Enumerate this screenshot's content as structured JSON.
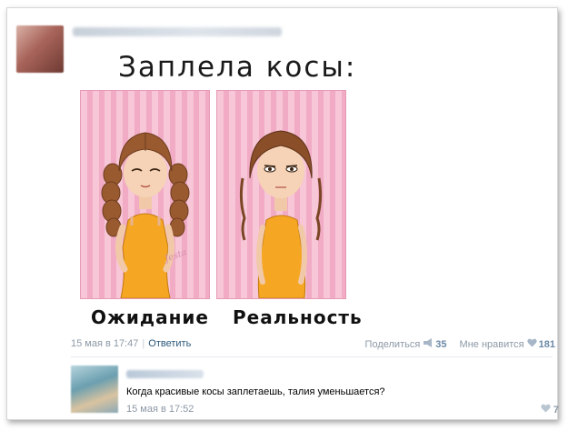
{
  "post": {
    "meme_title": "Заплела косы:",
    "captions": {
      "left": "Ожидание",
      "right": "Реальность"
    },
    "watermark": "Jesta",
    "date": "15 мая в 17:47",
    "reply_label": "Ответить",
    "share_label": "Поделиться",
    "share_count": "35",
    "like_label": "Мне нравится",
    "like_count": "181"
  },
  "comment": {
    "text": "Когда красивые косы заплетаешь, талия уменьшается?",
    "date": "15 мая в 17:52",
    "like_count": "7"
  },
  "colors": {
    "link": "#2b587a",
    "meta": "#8d99a6",
    "panel_pink": "#f7c6d7",
    "panel_stripe": "#f1abc4",
    "hair": "#9a5a30",
    "dress": "#f5a623"
  },
  "icons": [
    "megaphone-icon",
    "heart-icon"
  ]
}
